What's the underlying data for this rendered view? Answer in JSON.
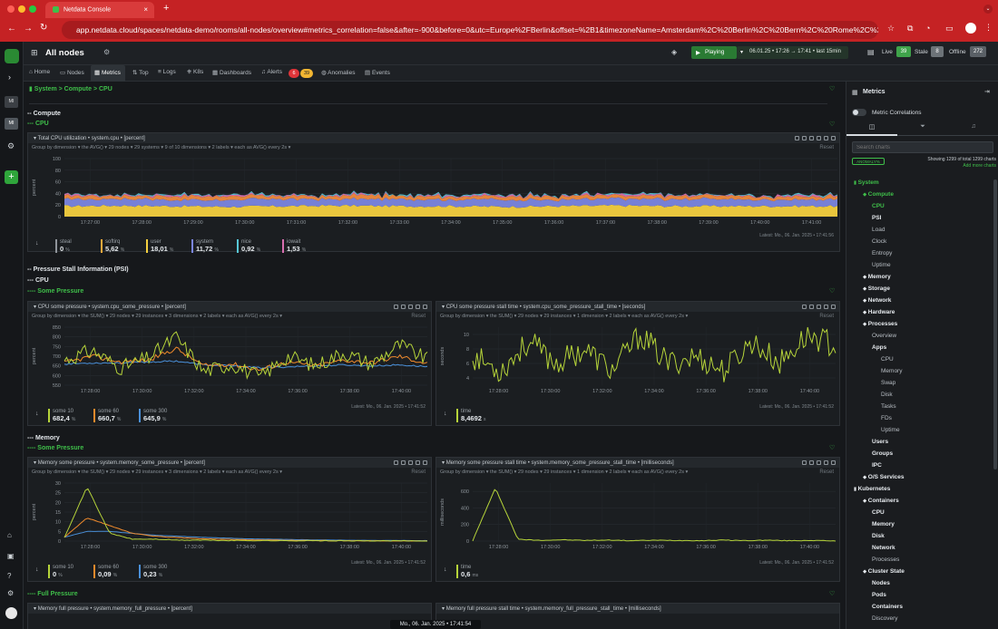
{
  "browser": {
    "tab_title": "Netdata Console",
    "new_tab": "+",
    "url": "app.netdata.cloud/spaces/netdata-demo/rooms/all-nodes/overview#metrics_correlation=false&after=-900&before=0&utc=Europe%2FBerlin&offset=%2B1&timezoneName=Amsterdam%2C%20Berlin%2C%20Bern%2C%20Rome%2C%20Stockhol..."
  },
  "sidebar": {
    "badges": [
      "MI",
      "MI"
    ]
  },
  "topbar": {
    "room": "All nodes",
    "playing": "Playing",
    "time_range": "06.01.25 • 17:26 → 17:41 • last 15min",
    "live_label": "Live",
    "live_count": "39",
    "stale_label": "Stale",
    "stale_count": "8",
    "offline_label": "Offline",
    "offline_count": "272"
  },
  "nav": {
    "tabs": [
      "Home",
      "Nodes",
      "Metrics",
      "Top",
      "Logs",
      "K8s",
      "Dashboards",
      "Alerts",
      "Anomalies",
      "Events"
    ],
    "alert_red": "6",
    "alert_yellow": "39"
  },
  "breadcrumb": "System > Compute > CPU",
  "sections": {
    "compute": "-- Compute",
    "cpu": "--- CPU",
    "psi": "-- Pressure Stall Information (PSI)",
    "psi_cpu": "--- CPU",
    "cpu_some": "---- Some Pressure",
    "memory": "--- Memory",
    "memory_some": "---- Some Pressure",
    "memory_full": "---- Full Pressure"
  },
  "cpu_card": {
    "title": "Total CPU utilization • system.cpu • [percent]",
    "sub": "Group by dimension ▾  the AVG() ▾  29 nodes ▾  29 systems ▾  9 of 10 dimensions ▾  2 labels ▾  each as AVG() every 2s ▾",
    "reset": "Reset",
    "ylabel": "percent",
    "yticks": [
      "100",
      "80",
      "60",
      "40",
      "20",
      "0"
    ],
    "xticks": [
      "17:27:00",
      "17:28:00",
      "17:29:00",
      "17:30:00",
      "17:31:00",
      "17:32:00",
      "17:33:00",
      "17:34:00",
      "17:35:00",
      "17:36:00",
      "17:37:00",
      "17:38:00",
      "17:39:00",
      "17:40:00",
      "17:41:00"
    ],
    "latest": "Latest: Mo., 06. Jan. 2025 • 17:41:56",
    "legend": [
      {
        "name": "steal",
        "value": "0",
        "unit": "%",
        "color": "#8f949a"
      },
      {
        "name": "softirq",
        "value": "5,62",
        "unit": "%",
        "color": "#f0a93c"
      },
      {
        "name": "user",
        "value": "18,01",
        "unit": "%",
        "color": "#f4d03f"
      },
      {
        "name": "system",
        "value": "11,72",
        "unit": "%",
        "color": "#7b86e0"
      },
      {
        "name": "nice",
        "value": "0,92",
        "unit": "%",
        "color": "#57c7d6"
      },
      {
        "name": "iowait",
        "value": "1,53",
        "unit": "%",
        "color": "#d86fb0"
      }
    ]
  },
  "psi_cpu_some": {
    "title": "CPU some pressure • system.cpu_some_pressure • [percent]",
    "sub": "Group by dimension ▾  the SUM() ▾  29 nodes ▾  29 instances ▾  3 dimensions ▾  2 labels ▾  each as AVG() every 2s ▾",
    "reset": "Reset",
    "ylabel": "percent",
    "yticks": [
      "850",
      "800",
      "750",
      "700",
      "650",
      "600",
      "550"
    ],
    "xticks": [
      "17:28:00",
      "17:30:00",
      "17:32:00",
      "17:34:00",
      "17:36:00",
      "17:38:00",
      "17:40:00"
    ],
    "latest": "Latest: Mo., 06. Jan. 2025 • 17:41:52",
    "legend": [
      {
        "name": "some 10",
        "value": "682,4",
        "unit": "%",
        "color": "#b6d43a"
      },
      {
        "name": "some 60",
        "value": "660,7",
        "unit": "%",
        "color": "#f08a2c"
      },
      {
        "name": "some 300",
        "value": "645,9",
        "unit": "%",
        "color": "#4a90d9"
      }
    ]
  },
  "psi_cpu_stall": {
    "title": "CPU some pressure stall time • system.cpu_some_pressure_stall_time • [seconds]",
    "sub": "Group by dimension ▾  the SUM() ▾  29 nodes ▾  29 instances ▾  1 dimension ▾  2 labels ▾  each as AVG() every 2s ▾",
    "reset": "Reset",
    "ylabel": "seconds",
    "yticks": [
      "10",
      "8",
      "6",
      "4"
    ],
    "xticks": [
      "17:28:00",
      "17:30:00",
      "17:32:00",
      "17:34:00",
      "17:36:00",
      "17:38:00",
      "17:40:00"
    ],
    "latest": "Latest: Mo., 06. Jan. 2025 • 17:41:52",
    "legend": [
      {
        "name": "time",
        "value": "8,4692",
        "unit": "s",
        "color": "#b6d43a"
      }
    ]
  },
  "psi_mem_some": {
    "title": "Memory some pressure • system.memory_some_pressure • [percent]",
    "sub": "Group by dimension ▾  the SUM() ▾  29 nodes ▾  29 instances ▾  3 dimensions ▾  2 labels ▾  each as AVG() every 2s ▾",
    "reset": "Reset",
    "ylabel": "percent",
    "yticks": [
      "30",
      "25",
      "20",
      "15",
      "10",
      "5",
      "0"
    ],
    "xticks": [
      "17:28:00",
      "17:30:00",
      "17:32:00",
      "17:34:00",
      "17:36:00",
      "17:38:00",
      "17:40:00"
    ],
    "latest": "Latest: Mo., 06. Jan. 2025 • 17:41:52",
    "legend": [
      {
        "name": "some 10",
        "value": "0",
        "unit": "%",
        "color": "#b6d43a"
      },
      {
        "name": "some 60",
        "value": "0,09",
        "unit": "%",
        "color": "#f08a2c"
      },
      {
        "name": "some 300",
        "value": "0,23",
        "unit": "%",
        "color": "#4a90d9"
      }
    ]
  },
  "psi_mem_stall": {
    "title": "Memory some pressure stall time • system.memory_some_pressure_stall_time • [milliseconds]",
    "sub": "Group by dimension ▾  the SUM() ▾  29 nodes ▾  29 instances ▾  1 dimension ▾  2 labels ▾  each as AVG() every 2s ▾",
    "reset": "Reset",
    "ylabel": "milliseconds",
    "yticks": [
      "600",
      "400",
      "200",
      "0"
    ],
    "xticks": [
      "17:28:00",
      "17:30:00",
      "17:32:00",
      "17:34:00",
      "17:36:00",
      "17:38:00",
      "17:40:00"
    ],
    "latest": "Latest: Mo., 06. Jan. 2025 • 17:41:52",
    "legend": [
      {
        "name": "time",
        "value": "0,6",
        "unit": "ms",
        "color": "#b6d43a"
      }
    ]
  },
  "mem_full_left_title": "Memory full pressure • system.memory_full_pressure • [percent]",
  "mem_full_right_title": "Memory full pressure stall time • system.memory_full_pressure_stall_time • [milliseconds]",
  "footer_time": "Mo., 06. Jan. 2025 • 17:41:54",
  "right_panel": {
    "title": "Metrics",
    "correlations": "Metric Correlations",
    "search_placeholder": "Search charts",
    "anomaly_badge": "ANOMALY%",
    "showing": "Showing 1299 of total 1299 charts",
    "add_more": "Add more charts",
    "tree": [
      {
        "label": "System",
        "level": 0,
        "bold": true,
        "green": true
      },
      {
        "label": "Compute",
        "level": 1,
        "bold": true,
        "green": true
      },
      {
        "label": "CPU",
        "level": 2,
        "bold": true,
        "green": true
      },
      {
        "label": "PSI",
        "level": 2,
        "bold": true
      },
      {
        "label": "Load",
        "level": 2
      },
      {
        "label": "Clock",
        "level": 2
      },
      {
        "label": "Entropy",
        "level": 2
      },
      {
        "label": "Uptime",
        "level": 2
      },
      {
        "label": "Memory",
        "level": 1,
        "bold": true
      },
      {
        "label": "Storage",
        "level": 1,
        "bold": true
      },
      {
        "label": "Network",
        "level": 1,
        "bold": true
      },
      {
        "label": "Hardware",
        "level": 1,
        "bold": true
      },
      {
        "label": "Processes",
        "level": 1,
        "bold": true
      },
      {
        "label": "Overview",
        "level": 2
      },
      {
        "label": "Apps",
        "level": 2,
        "bold": true
      },
      {
        "label": "CPU",
        "level": 3
      },
      {
        "label": "Memory",
        "level": 3
      },
      {
        "label": "Swap",
        "level": 3
      },
      {
        "label": "Disk",
        "level": 3
      },
      {
        "label": "Tasks",
        "level": 3
      },
      {
        "label": "FDs",
        "level": 3
      },
      {
        "label": "Uptime",
        "level": 3
      },
      {
        "label": "Users",
        "level": 2,
        "bold": true
      },
      {
        "label": "Groups",
        "level": 2,
        "bold": true
      },
      {
        "label": "IPC",
        "level": 2,
        "bold": true
      },
      {
        "label": "O/S Services",
        "level": 1,
        "bold": true
      },
      {
        "label": "Kubernetes",
        "level": 0,
        "bold": true
      },
      {
        "label": "Containers",
        "level": 1,
        "bold": true
      },
      {
        "label": "CPU",
        "level": 2,
        "bold": true
      },
      {
        "label": "Memory",
        "level": 2,
        "bold": true
      },
      {
        "label": "Disk",
        "level": 2,
        "bold": true
      },
      {
        "label": "Network",
        "level": 2,
        "bold": true
      },
      {
        "label": "Processes",
        "level": 2
      },
      {
        "label": "Cluster State",
        "level": 1,
        "bold": true
      },
      {
        "label": "Nodes",
        "level": 2,
        "bold": true
      },
      {
        "label": "Pods",
        "level": 2,
        "bold": true
      },
      {
        "label": "Containers",
        "level": 2,
        "bold": true
      },
      {
        "label": "Discovery",
        "level": 2
      }
    ]
  },
  "chart_data": [
    {
      "type": "area",
      "title": "Total CPU utilization • system.cpu • [percent]",
      "ylabel": "percent",
      "ylim": [
        0,
        100
      ],
      "x": [
        "17:27:00",
        "17:28:00",
        "17:29:00",
        "17:30:00",
        "17:31:00",
        "17:32:00",
        "17:33:00",
        "17:34:00",
        "17:35:00",
        "17:36:00",
        "17:37:00",
        "17:38:00",
        "17:39:00",
        "17:40:00",
        "17:41:00"
      ],
      "series": [
        {
          "name": "user",
          "values": [
            18,
            19,
            18,
            17,
            18,
            19,
            18,
            18,
            17,
            18,
            19,
            18,
            18,
            18,
            18
          ]
        },
        {
          "name": "system",
          "values": [
            12,
            12,
            11,
            12,
            12,
            11,
            12,
            12,
            12,
            11,
            12,
            12,
            12,
            11,
            12
          ]
        },
        {
          "name": "softirq",
          "values": [
            6,
            5,
            6,
            6,
            5,
            6,
            6,
            5,
            6,
            6,
            5,
            6,
            6,
            5,
            6
          ]
        },
        {
          "name": "iowait",
          "values": [
            2,
            1,
            2,
            2,
            1,
            2,
            1,
            2,
            2,
            1,
            2,
            2,
            1,
            2,
            2
          ]
        },
        {
          "name": "nice",
          "values": [
            1,
            1,
            1,
            1,
            1,
            1,
            1,
            1,
            1,
            1,
            1,
            1,
            1,
            1,
            1
          ]
        }
      ]
    },
    {
      "type": "line",
      "title": "CPU some pressure • system.cpu_some_pressure • [percent]",
      "ylabel": "percent",
      "ylim": [
        550,
        850
      ],
      "x": [
        "17:28:00",
        "17:29:00",
        "17:30:00",
        "17:31:00",
        "17:32:00",
        "17:33:00",
        "17:34:00",
        "17:35:00",
        "17:36:00",
        "17:37:00",
        "17:38:00",
        "17:39:00",
        "17:40:00",
        "17:41:00"
      ],
      "series": [
        {
          "name": "some 10",
          "values": [
            680,
            730,
            640,
            690,
            800,
            620,
            660,
            590,
            700,
            650,
            720,
            660,
            760,
            682
          ]
        },
        {
          "name": "some 60",
          "values": [
            665,
            700,
            670,
            680,
            740,
            650,
            660,
            630,
            670,
            650,
            680,
            665,
            700,
            661
          ]
        },
        {
          "name": "some 300",
          "values": [
            660,
            665,
            665,
            670,
            675,
            655,
            650,
            640,
            645,
            650,
            655,
            650,
            655,
            646
          ]
        }
      ]
    },
    {
      "type": "line",
      "title": "CPU some pressure stall time • system.cpu_some_pressure_stall_time • [seconds]",
      "ylabel": "seconds",
      "ylim": [
        3,
        11
      ],
      "x": [
        "17:28:00",
        "17:29:00",
        "17:30:00",
        "17:31:00",
        "17:32:00",
        "17:33:00",
        "17:34:00",
        "17:35:00",
        "17:36:00",
        "17:37:00",
        "17:38:00",
        "17:39:00",
        "17:40:00",
        "17:41:00"
      ],
      "series": [
        {
          "name": "time",
          "values": [
            7,
            5,
            9,
            6,
            8,
            5,
            10,
            6,
            7,
            5,
            9,
            6,
            10,
            8.4692
          ]
        }
      ]
    },
    {
      "type": "line",
      "title": "Memory some pressure • system.memory_some_pressure • [percent]",
      "ylabel": "percent",
      "ylim": [
        0,
        30
      ],
      "x": [
        "17:27:00",
        "17:27:20",
        "17:27:40",
        "17:28:00",
        "17:29:00",
        "17:30:00",
        "17:31:00",
        "17:32:00",
        "17:33:00",
        "17:34:00",
        "17:35:00",
        "17:36:00",
        "17:37:00",
        "17:38:00",
        "17:39:00",
        "17:40:00",
        "17:41:00"
      ],
      "series": [
        {
          "name": "some 10",
          "values": [
            2,
            28,
            4,
            1,
            1,
            0.5,
            0.5,
            0.3,
            0.3,
            0.2,
            0.2,
            0.2,
            0.1,
            0.1,
            0.1,
            0.1,
            0
          ]
        },
        {
          "name": "some 60",
          "values": [
            2,
            12,
            8,
            4,
            2.5,
            1.8,
            1.2,
            0.9,
            0.7,
            0.5,
            0.4,
            0.3,
            0.2,
            0.2,
            0.1,
            0.1,
            0.09
          ]
        },
        {
          "name": "some 300",
          "values": [
            2,
            5,
            5,
            4,
            3,
            2.5,
            2,
            1.6,
            1.2,
            1,
            0.8,
            0.6,
            0.5,
            0.4,
            0.3,
            0.3,
            0.23
          ]
        }
      ]
    },
    {
      "type": "line",
      "title": "Memory some pressure stall time • system.memory_some_pressure_stall_time • [milliseconds]",
      "ylabel": "milliseconds",
      "ylim": [
        0,
        700
      ],
      "x": [
        "17:27:00",
        "17:27:30",
        "17:28:00",
        "17:28:30",
        "17:29:00",
        "17:30:00",
        "17:31:00",
        "17:32:00",
        "17:33:00",
        "17:34:00",
        "17:35:00",
        "17:36:00",
        "17:37:00",
        "17:38:00",
        "17:39:00",
        "17:40:00",
        "17:41:00"
      ],
      "series": [
        {
          "name": "time",
          "values": [
            5,
            640,
            20,
            10,
            15,
            8,
            12,
            5,
            10,
            8,
            5,
            12,
            6,
            10,
            5,
            8,
            0.6
          ]
        }
      ]
    }
  ]
}
